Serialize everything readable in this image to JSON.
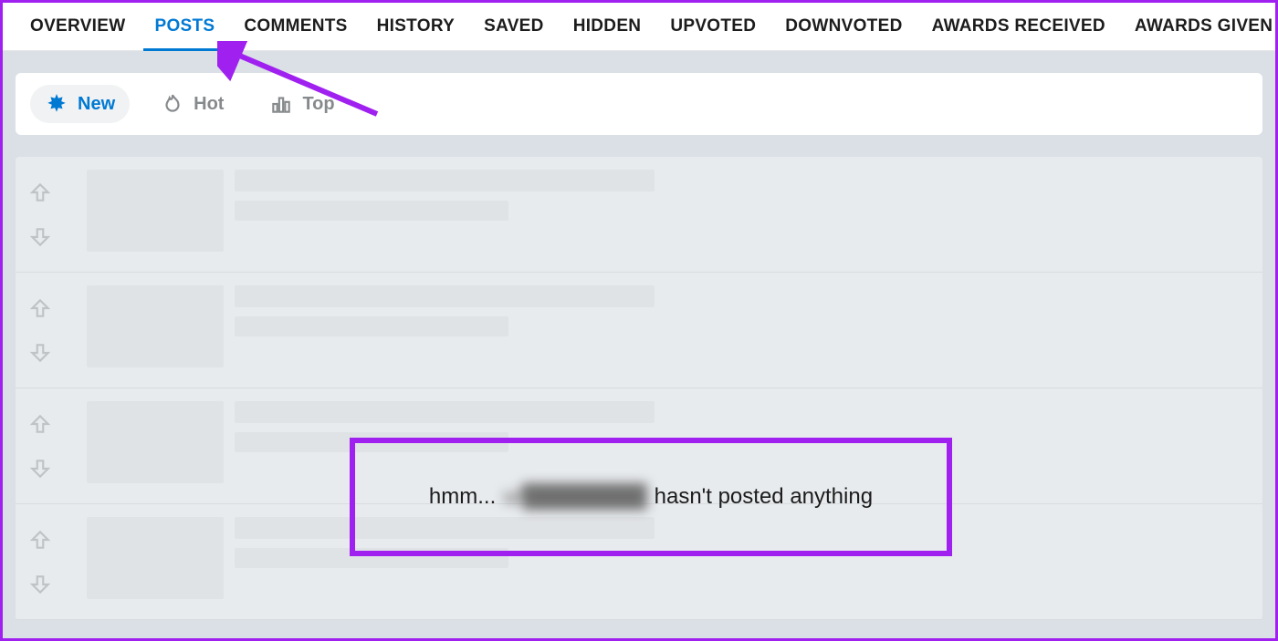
{
  "tabs": [
    {
      "label": "OVERVIEW"
    },
    {
      "label": "POSTS"
    },
    {
      "label": "COMMENTS"
    },
    {
      "label": "HISTORY"
    },
    {
      "label": "SAVED"
    },
    {
      "label": "HIDDEN"
    },
    {
      "label": "UPVOTED"
    },
    {
      "label": "DOWNVOTED"
    },
    {
      "label": "AWARDS RECEIVED"
    },
    {
      "label": "AWARDS GIVEN"
    }
  ],
  "active_tab_index": 1,
  "sort": {
    "options": [
      {
        "label": "New",
        "icon": "burst"
      },
      {
        "label": "Hot",
        "icon": "flame"
      },
      {
        "label": "Top",
        "icon": "bars"
      }
    ],
    "active_index": 0
  },
  "empty_message": {
    "prefix": "hmm... ",
    "blurred": "u/████████",
    "suffix": " hasn't posted anything"
  },
  "annotation_color": "#a020f0"
}
